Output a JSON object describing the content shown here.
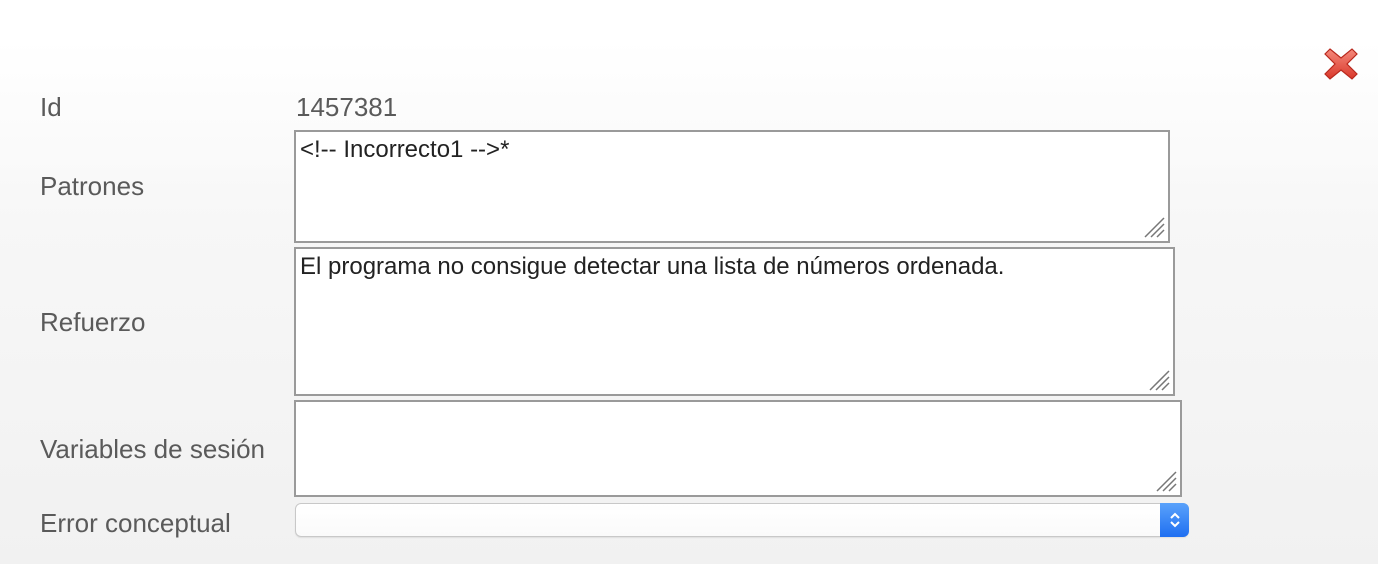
{
  "icons": {
    "close": "close-icon"
  },
  "fields": {
    "id": {
      "label": "Id",
      "value": "1457381"
    },
    "patrones": {
      "label": "Patrones",
      "value": "<!-- Incorrecto1 -->*"
    },
    "refuerzo": {
      "label": "Refuerzo",
      "value": "El programa no consigue detectar una lista de números ordenada."
    },
    "variables_sesion": {
      "label": "Variables de sesión",
      "value": ""
    },
    "error_conceptual": {
      "label": "Error conceptual",
      "selected": ""
    }
  },
  "colors": {
    "close_red": "#e8493a",
    "select_accent": "#2b7cf6",
    "label_text": "#5a5a5a"
  }
}
